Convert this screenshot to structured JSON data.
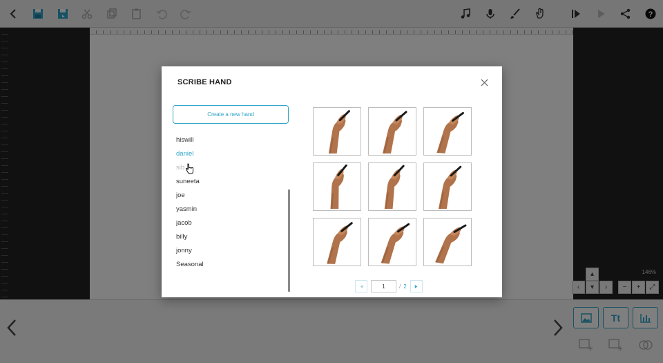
{
  "toolbar": {
    "icons": [
      "back-arrow-icon",
      "save-icon",
      "save-as-icon",
      "cut-icon",
      "copy-icon",
      "paste-icon",
      "undo-icon",
      "redo-icon",
      "music-icon",
      "microphone-icon",
      "brush-icon",
      "hand-icon",
      "play-from-icon",
      "play-icon",
      "share-icon",
      "help-icon"
    ]
  },
  "canvas": {
    "zoom_label": "146%"
  },
  "bottom": {
    "insert_image": "image-icon",
    "insert_text": "Tt",
    "insert_chart": "chart-icon"
  },
  "modal": {
    "title": "SCRIBE HAND",
    "create_button": "Create a new hand",
    "hands": [
      {
        "label": "hiswill",
        "state": "normal"
      },
      {
        "label": "daniel",
        "state": "active"
      },
      {
        "label": "sib",
        "state": "hover"
      },
      {
        "label": "suneeta",
        "state": "normal"
      },
      {
        "label": "joe",
        "state": "normal"
      },
      {
        "label": "yasmin",
        "state": "normal"
      },
      {
        "label": "jacob",
        "state": "normal"
      },
      {
        "label": "billy",
        "state": "normal"
      },
      {
        "label": "jonny",
        "state": "normal"
      },
      {
        "label": "Seasonal",
        "state": "normal"
      }
    ],
    "thumbnails": 9,
    "pagination": {
      "current": "1",
      "separator": "/",
      "total": "2"
    }
  },
  "colors": {
    "accent": "#2fa4c8",
    "overlay": "rgba(0,0,0,0.5)"
  }
}
